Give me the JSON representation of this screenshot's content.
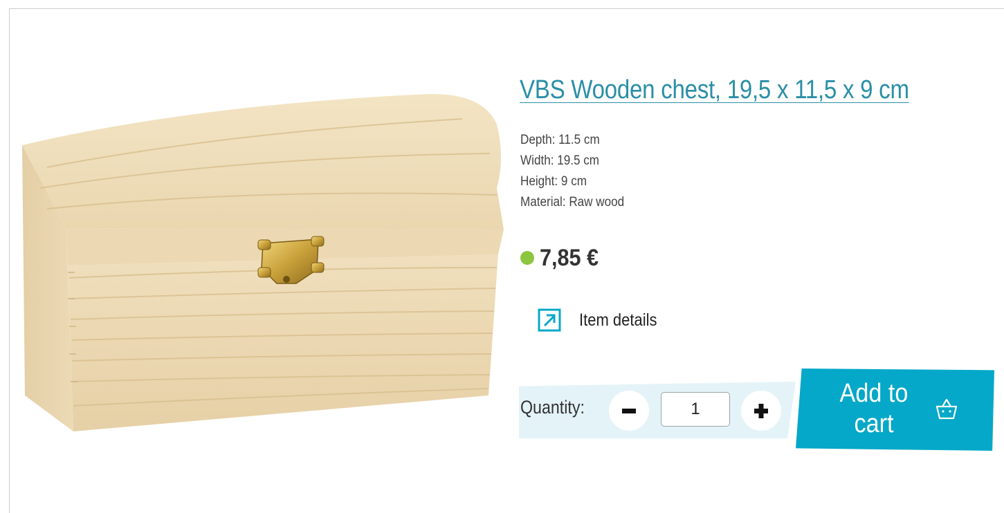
{
  "product": {
    "title": "VBS Wooden chest, 19,5 x 11,5 x 9 cm",
    "image_alt": "Wooden chest with curved lid and brass clasp",
    "specs": [
      "Depth: 11.5 cm",
      "Width: 19.5 cm",
      "Height: 9 cm",
      "Material: Raw wood"
    ],
    "price": "7,85 €",
    "availability_color": "#8cc63f"
  },
  "details": {
    "label": "Item details",
    "icon": "external-link-arrow-icon"
  },
  "quantity": {
    "label": "Quantity:",
    "value": "1",
    "decrement_icon": "minus-icon",
    "increment_icon": "plus-icon"
  },
  "cart": {
    "label": "Add to cart",
    "icon": "basket-icon",
    "color": "#05a8c8"
  },
  "theme": {
    "link_color": "#2a8fa6",
    "band_color": "#e4f3f8"
  }
}
